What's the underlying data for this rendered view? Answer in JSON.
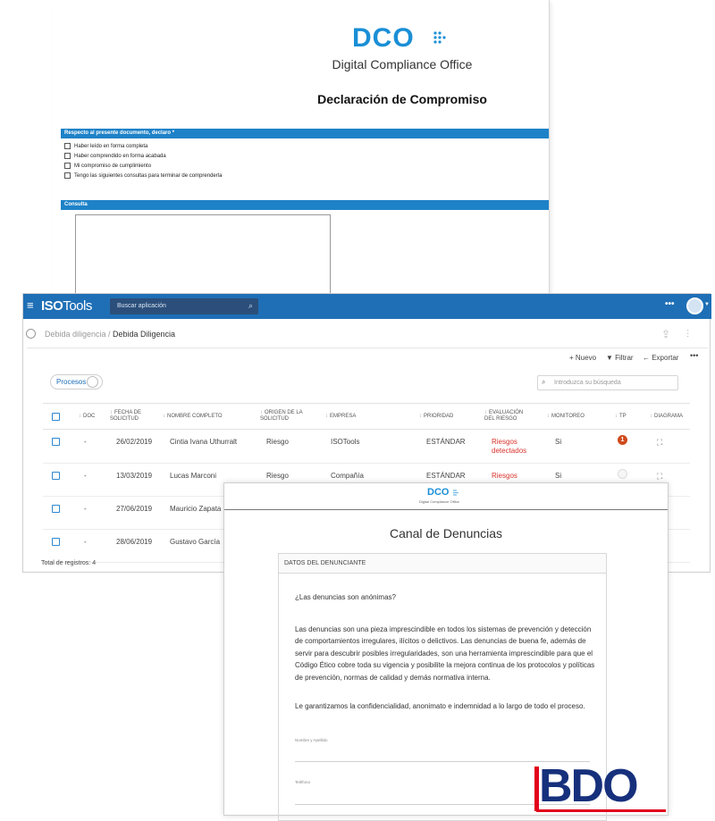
{
  "dco_form": {
    "logo_text": "DCO",
    "org_name": "Digital Compliance Office",
    "title": "Declaración de Compromiso",
    "section_1": "Respecto al presente documento, declaro *",
    "checks": [
      "Haber leído en forma completa",
      "Haber comprendido en forma acabada",
      "Mi compromiso de cumplimiento",
      "Tengo las siguientes consultas para terminar de comprenderla"
    ],
    "section_2": "Consulta"
  },
  "isotools": {
    "menu_icon": "≡",
    "logo_bold": "ISO",
    "logo_rest": "Tools",
    "search_placeholder": "Buscar aplicación",
    "more": "•••",
    "breadcrumb": [
      "Debida diligencia /",
      "Debida Diligencia"
    ],
    "actions": {
      "nuevo": "+ Nuevo",
      "filtrar": "▼ Filtrar",
      "exportar": "← Exportar",
      "more": "•••"
    },
    "procesos": "Procesos",
    "search_field": "Introduzca su búsqueda",
    "columns": {
      "doc": "DOC",
      "fecha": "FECHA DE SOLICITUD",
      "nombre": "NOMBRE COMPLETO",
      "origen": "ORIGEN DE LA SOLICITUD",
      "empresa": "EMPRESA",
      "prioridad": "PRIORIDAD",
      "evaluacion": "EVALUACIÓN DEL RIESGO",
      "monitoreo": "MONITOREO",
      "tp": "TP",
      "diagrama": "DIAGRAMA"
    },
    "rows": [
      {
        "doc": "-",
        "fecha": "26/02/2019",
        "nombre": "Cintia Ivana Uthurralt",
        "origen": "Riesgo",
        "empresa": "ISOTools",
        "prioridad": "ESTÁNDAR",
        "evaluacion": "Riesgos detectados",
        "monitoreo": "Si",
        "tp": "1"
      },
      {
        "doc": "-",
        "fecha": "13/03/2019",
        "nombre": "Lucas Marconi",
        "origen": "Riesgo",
        "empresa": "Compañía",
        "prioridad": "ESTÁNDAR",
        "evaluacion": "Riesgos",
        "monitoreo": "Si",
        "tp": ""
      },
      {
        "doc": "-",
        "fecha": "27/06/2019",
        "nombre": "Mauricio Zapata"
      },
      {
        "doc": "-",
        "fecha": "28/06/2019",
        "nombre": "Gustavo García"
      }
    ],
    "total": "Total de registros: 4",
    "colors": {
      "topbar": "#1f6fb6",
      "risk": "#d8322b",
      "badge": "#cf4a1d"
    }
  },
  "canal": {
    "logo_text": "DCO",
    "logo_sub": "Digital Compliance Office",
    "title": "Canal de Denuncias",
    "box_header": "DATOS DEL DENUNCIANTE",
    "question": "¿Las denuncias son anónimas?",
    "paragraph_1": "Las denuncias son una pieza imprescindible en todos los sistemas de prevención y detección de comportamientos irregulares, ilícitos o delictivos. Las denuncias de buena fe, además de servir para descubrir posibles irregularidades, son una herramienta imprescindible para que el Código Ético cobre toda su vigencia y posibilite la mejora continua de los protocolos y políticas de prevención, normas de calidad y demás normativa interna.",
    "paragraph_2": "Le garantizamos la confidencialidad, anonimato e indemnidad a lo largo de todo el proceso.",
    "field_1": "Nombre y Apellido",
    "field_2": "Teléfono"
  },
  "bdo": {
    "text": "BDO",
    "colors": {
      "navy": "#16307c",
      "red": "#e2001a"
    }
  }
}
